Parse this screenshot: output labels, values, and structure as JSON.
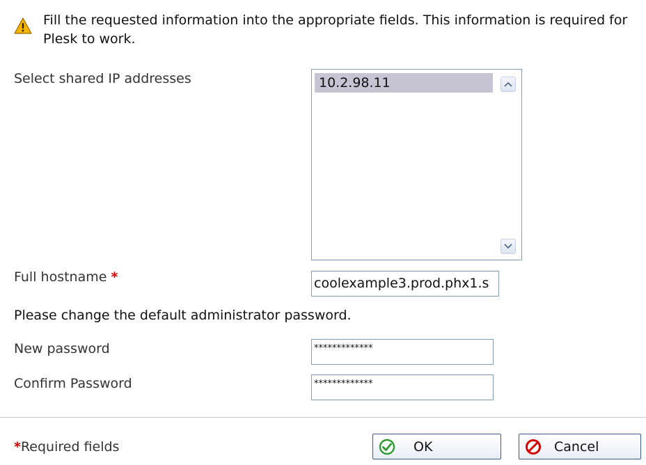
{
  "notice": {
    "icon": "warning-icon",
    "text": "Fill the requested information into the appropriate fields. This information is required for Plesk to work."
  },
  "shared_ip": {
    "label": "Select shared IP addresses",
    "options": [
      "10.2.98.11"
    ],
    "selected": "10.2.98.11"
  },
  "hostname": {
    "label": "Full hostname",
    "required_mark": "*",
    "value": "coolexample3.prod.phx1.s"
  },
  "password_section": {
    "heading": "Please change the default administrator password.",
    "new_password_label": "New password",
    "new_password_value": "*************",
    "confirm_password_label": "Confirm Password",
    "confirm_password_value": "*************"
  },
  "footer": {
    "required_mark": "*",
    "required_note": "Required fields",
    "ok_label": "OK",
    "cancel_label": "Cancel"
  },
  "colors": {
    "required": "#cc0000",
    "selection": "#c5c5d3",
    "field_border": "#7f9db9",
    "ok_icon": "#2e9a2e",
    "cancel_icon": "#d40000",
    "warning_icon": "#f5b400"
  }
}
